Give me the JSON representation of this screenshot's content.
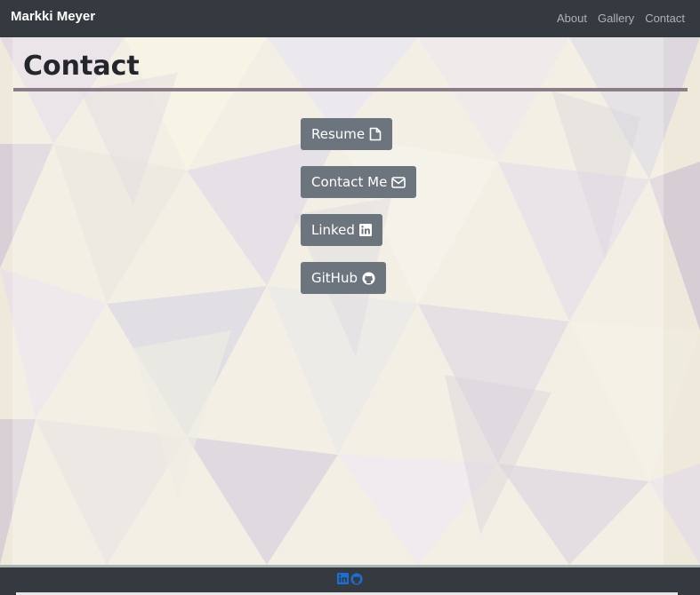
{
  "navbar": {
    "brand": "Markki Meyer",
    "links": [
      "About",
      "Gallery",
      "Contact"
    ]
  },
  "page": {
    "title": "Contact"
  },
  "buttons": {
    "resume": "Resume",
    "contact_me": "Contact Me",
    "linked": "Linked",
    "github": "GitHub"
  },
  "colors": {
    "navbar_bg": "#343a40",
    "button_bg": "#6c757d",
    "title_rule": "#8c7c87",
    "footer_icon": "#1a6fd6"
  },
  "icons": {
    "resume": "file-icon",
    "contact_me": "envelope-icon",
    "linked": "linkedin-icon",
    "github": "github-icon",
    "footer": [
      "linkedin-icon",
      "github-icon"
    ]
  }
}
